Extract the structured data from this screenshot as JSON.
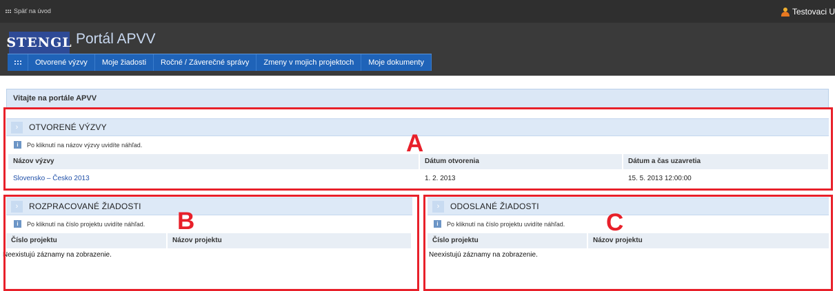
{
  "topbar": {
    "back_label": "Späť na úvod",
    "user_name": "Testovaci U"
  },
  "header": {
    "logo_text": "STENGL",
    "portal_title": "Portál APVV"
  },
  "nav": {
    "items": [
      "Otvorené výzvy",
      "Moje žiadosti",
      "Ročné / Záverečné správy",
      "Zmeny v mojich projektoch",
      "Moje dokumenty"
    ]
  },
  "welcome": "Vitajte na portále APVV",
  "open_calls": {
    "title": "OTVORENÉ VÝZVY",
    "info": "Po kliknutí na názov výzvy uvidíte náhľad.",
    "columns": [
      "Názov výzvy",
      "Dátum otvorenia",
      "Dátum a čas uzavretia"
    ],
    "rows": [
      {
        "name": "Slovensko – Česko 2013",
        "opened": "1. 2. 2013",
        "closes": "15. 5. 2013 12:00:00"
      }
    ]
  },
  "in_progress": {
    "title": "ROZPRACOVANÉ ŽIADOSTI",
    "info": "Po kliknutí na číslo projektu uvidíte náhľad.",
    "columns": [
      "Číslo projektu",
      "Názov projektu"
    ],
    "empty": "Neexistujú záznamy na zobrazenie."
  },
  "sent": {
    "title": "ODOSLANÉ ŽIADOSTI",
    "info": "Po kliknutí na číslo projektu uvidíte náhľad.",
    "columns": [
      "Číslo projektu",
      "Názov projektu"
    ],
    "empty": "Neexistujú záznamy na zobrazenie."
  },
  "annotations": {
    "a": "A",
    "b": "B",
    "c": "C"
  },
  "colors": {
    "annotation": "#e8202a",
    "nav": "#1f63b8",
    "logo": "#2e4a96",
    "panel_head": "#dde9f7"
  }
}
